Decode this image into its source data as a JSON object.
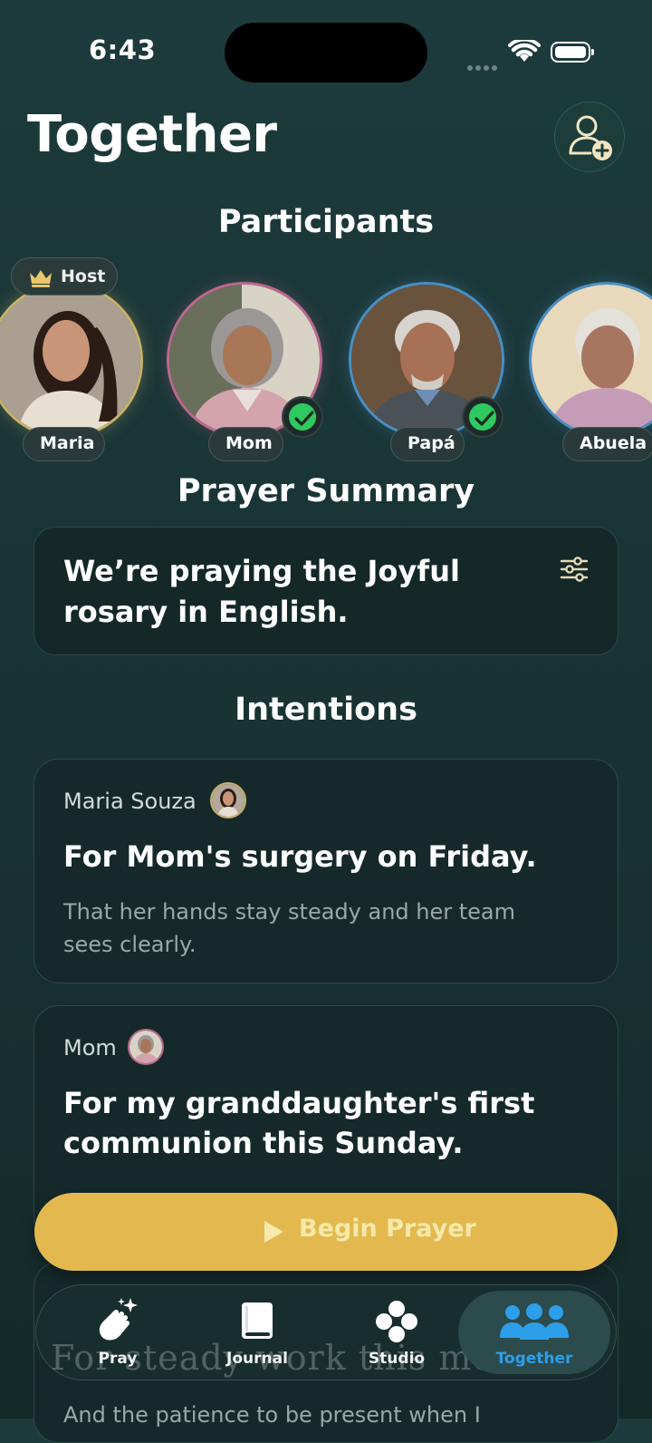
{
  "status": {
    "time": "6:43"
  },
  "header": {
    "title": "Together",
    "add_person_icon": "add-person-icon"
  },
  "participants_heading": "Participants",
  "host_label": "Host",
  "participants": [
    {
      "name": "Maria",
      "ring_color": "#c8b26b",
      "host": true,
      "checked": false
    },
    {
      "name": "Mom",
      "ring_color": "#b96a8d",
      "host": false,
      "checked": true
    },
    {
      "name": "Papá",
      "ring_color": "#4b8fc2",
      "host": false,
      "checked": true
    },
    {
      "name": "Abuela",
      "ring_color": "#4b8fc2",
      "host": false,
      "checked": false
    }
  ],
  "summary_heading": "Prayer Summary",
  "summary_text": "We’re praying the Joyful rosary in English.",
  "intentions_heading": "Intentions",
  "intentions": [
    {
      "author": "Maria Souza",
      "title": "For Mom's surgery on Friday.",
      "body": "That her hands stay steady and her team sees clearly."
    },
    {
      "author": "Mom",
      "title": "For my granddaughter's first communion this Sunday.",
      "body": ""
    },
    {
      "author": "",
      "title": "For steady work this month",
      "body": "And the patience to be present when I"
    }
  ],
  "begin_button": "Begin Prayer",
  "tabs": [
    {
      "label": "Pray",
      "icon": "praying-hands-icon",
      "active": false
    },
    {
      "label": "Journal",
      "icon": "book-icon",
      "active": false
    },
    {
      "label": "Studio",
      "icon": "studio-icon",
      "active": false
    },
    {
      "label": "Together",
      "icon": "group-icon",
      "active": true
    }
  ],
  "colors": {
    "accent_gold": "#e3b94f",
    "active_tab": "#2d9fea",
    "check_green": "#2fc961"
  }
}
